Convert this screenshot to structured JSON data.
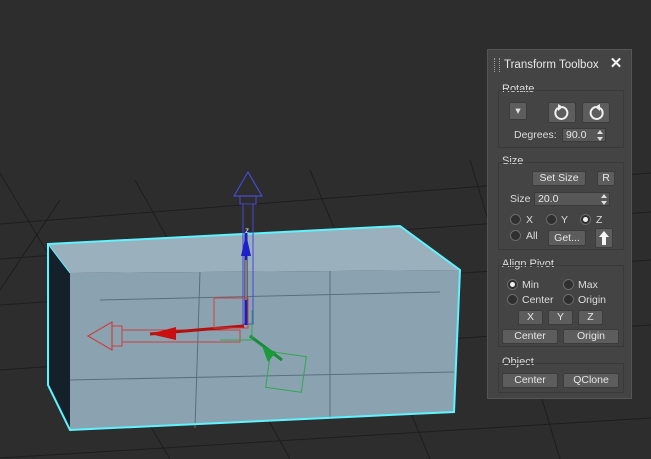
{
  "viewport": {
    "gizmo_axis_label": "z",
    "icons": [
      "move-gizmo-z-arrow-icon",
      "move-gizmo-x-arrow-icon",
      "move-gizmo-y-arrow-icon"
    ],
    "colors": {
      "background": "#2d2d2d",
      "box_face": "#8fa7b5",
      "box_selection": "#5ff2ff",
      "axis_z": "#3a3acc",
      "axis_x": "#cc3a3a",
      "axis_y": "#2fa84f"
    }
  },
  "toolbox": {
    "title": "Transform Toolbox",
    "close_label": "✕",
    "rotate": {
      "label": "Rotate",
      "dropdown_label": "▾",
      "degrees_label": "Degrees:",
      "degrees_value": "90.0",
      "icons": [
        "rotate-ccw-icon",
        "rotate-cw-icon"
      ]
    },
    "size": {
      "label": "Size",
      "set_size_label": "Set Size",
      "r_label": "R",
      "size_label": "Size",
      "size_value": "20.0",
      "axis_options": [
        "X",
        "Y",
        "Z"
      ],
      "selected_axis": "Z",
      "all_label": "All",
      "get_label": "Get...",
      "icons": [
        "arrow-up-icon"
      ]
    },
    "align_pivot": {
      "label": "Align Pivot",
      "options": [
        "Min",
        "Max",
        "Center",
        "Origin"
      ],
      "selected": "Min",
      "x_label": "X",
      "y_label": "Y",
      "z_label": "Z",
      "center_label": "Center",
      "origin_label": "Origin"
    },
    "object": {
      "label": "Object",
      "center_label": "Center",
      "qclone_label": "QClone"
    }
  }
}
